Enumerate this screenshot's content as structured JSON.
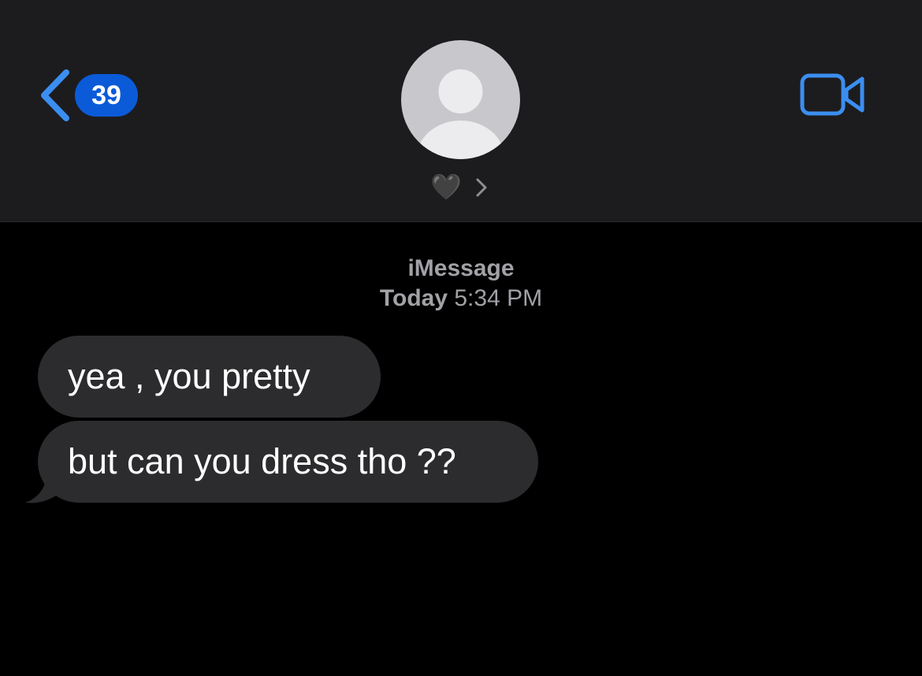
{
  "header": {
    "back_badge_count": "39",
    "contact_name": "🖤",
    "back_icon": "chevron-left-icon",
    "video_icon": "video-camera-icon",
    "accent_color": "#3b8ef0",
    "badge_color": "#0b5bd9"
  },
  "conversation": {
    "service": "iMessage",
    "day": "Today",
    "time": "5:34 PM",
    "messages": [
      {
        "direction": "incoming",
        "text": "yea , you pretty"
      },
      {
        "direction": "incoming",
        "text": "but can you dress tho ??"
      }
    ]
  }
}
